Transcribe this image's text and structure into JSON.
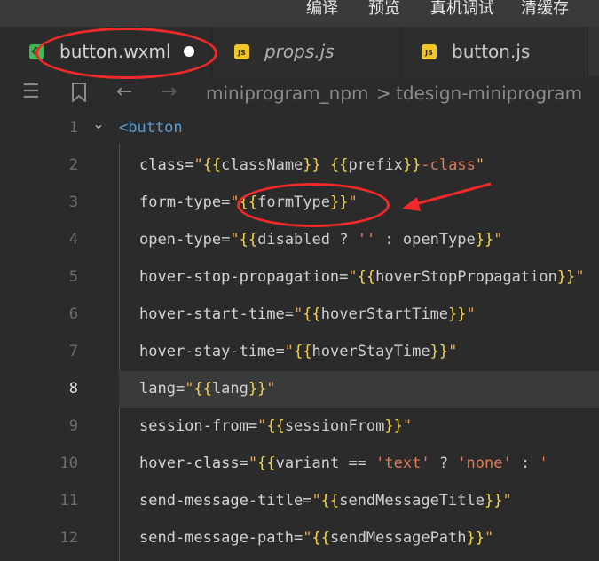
{
  "menu": {
    "items": [
      "编译",
      "预览",
      "真机调试",
      "清缓存"
    ]
  },
  "tabs": [
    {
      "label": "button.wxml",
      "icon": "wxml-file-icon",
      "active": true,
      "modified": true
    },
    {
      "label": "props.js",
      "icon": "js-file-icon",
      "active": false,
      "modified": false,
      "preview": true
    },
    {
      "label": "button.js",
      "icon": "js-file-icon",
      "active": false,
      "modified": false
    }
  ],
  "js_icon_text": "JS",
  "breadcrumb": {
    "items": [
      "miniprogram_npm",
      "tdesign-miniprogram"
    ],
    "separator": ">"
  },
  "editor": {
    "current_line": 8,
    "lines": [
      {
        "n": "1",
        "t": [
          [
            "tag",
            "<button"
          ]
        ]
      },
      {
        "n": "2",
        "t": [
          [
            "attr",
            "class"
          ],
          [
            "op",
            "="
          ],
          [
            "quote",
            "\""
          ],
          [
            "brace",
            "{{"
          ],
          [
            "var",
            "className"
          ],
          [
            "brace",
            "}}"
          ],
          [
            "op",
            " "
          ],
          [
            "brace",
            "{{"
          ],
          [
            "var",
            "prefix"
          ],
          [
            "brace",
            "}}"
          ],
          [
            "str",
            "-class"
          ],
          [
            "quote",
            "\""
          ]
        ]
      },
      {
        "n": "3",
        "t": [
          [
            "attr",
            "form-type"
          ],
          [
            "op",
            "="
          ],
          [
            "quote",
            "\""
          ],
          [
            "brace",
            "{{"
          ],
          [
            "var",
            "formType"
          ],
          [
            "brace",
            "}}"
          ],
          [
            "quote",
            "\""
          ]
        ]
      },
      {
        "n": "4",
        "t": [
          [
            "attr",
            "open-type"
          ],
          [
            "op",
            "="
          ],
          [
            "quote",
            "\""
          ],
          [
            "brace",
            "{{"
          ],
          [
            "var",
            "disabled ? "
          ],
          [
            "str",
            "''"
          ],
          [
            "var",
            " : openType"
          ],
          [
            "brace",
            "}}"
          ],
          [
            "quote",
            "\""
          ]
        ]
      },
      {
        "n": "5",
        "t": [
          [
            "attr",
            "hover-stop-propagation"
          ],
          [
            "op",
            "="
          ],
          [
            "quote",
            "\""
          ],
          [
            "brace",
            "{{"
          ],
          [
            "var",
            "hoverStopPropagation"
          ],
          [
            "brace",
            "}}"
          ],
          [
            "quote",
            "\""
          ]
        ]
      },
      {
        "n": "6",
        "t": [
          [
            "attr",
            "hover-start-time"
          ],
          [
            "op",
            "="
          ],
          [
            "quote",
            "\""
          ],
          [
            "brace",
            "{{"
          ],
          [
            "var",
            "hoverStartTime"
          ],
          [
            "brace",
            "}}"
          ],
          [
            "quote",
            "\""
          ]
        ]
      },
      {
        "n": "7",
        "t": [
          [
            "attr",
            "hover-stay-time"
          ],
          [
            "op",
            "="
          ],
          [
            "quote",
            "\""
          ],
          [
            "brace",
            "{{"
          ],
          [
            "var",
            "hoverStayTime"
          ],
          [
            "brace",
            "}}"
          ],
          [
            "quote",
            "\""
          ]
        ]
      },
      {
        "n": "8",
        "t": [
          [
            "attr",
            "lang"
          ],
          [
            "op",
            "="
          ],
          [
            "quote",
            "\""
          ],
          [
            "brace",
            "{{"
          ],
          [
            "var",
            "lang"
          ],
          [
            "brace",
            "}}"
          ],
          [
            "quote",
            "\""
          ]
        ]
      },
      {
        "n": "9",
        "t": [
          [
            "attr",
            "session-from"
          ],
          [
            "op",
            "="
          ],
          [
            "quote",
            "\""
          ],
          [
            "brace",
            "{{"
          ],
          [
            "var",
            "sessionFrom"
          ],
          [
            "brace",
            "}}"
          ],
          [
            "quote",
            "\""
          ]
        ]
      },
      {
        "n": "10",
        "t": [
          [
            "attr",
            "hover-class"
          ],
          [
            "op",
            "="
          ],
          [
            "quote",
            "\""
          ],
          [
            "brace",
            "{{"
          ],
          [
            "var",
            "variant == "
          ],
          [
            "str",
            "'text'"
          ],
          [
            "var",
            " ? "
          ],
          [
            "str",
            "'none'"
          ],
          [
            "var",
            " : "
          ],
          [
            "str",
            "'"
          ]
        ]
      },
      {
        "n": "11",
        "t": [
          [
            "attr",
            "send-message-title"
          ],
          [
            "op",
            "="
          ],
          [
            "quote",
            "\""
          ],
          [
            "brace",
            "{{"
          ],
          [
            "var",
            "sendMessageTitle"
          ],
          [
            "brace",
            "}}"
          ],
          [
            "quote",
            "\""
          ]
        ]
      },
      {
        "n": "12",
        "t": [
          [
            "attr",
            "send-message-path"
          ],
          [
            "op",
            "="
          ],
          [
            "quote",
            "\""
          ],
          [
            "brace",
            "{{"
          ],
          [
            "var",
            "sendMessagePath"
          ],
          [
            "brace",
            "}}"
          ],
          [
            "quote",
            "\""
          ]
        ]
      }
    ]
  },
  "colors": {
    "annotation": "#f02a2a",
    "background": "#2b2b2b",
    "tag": "#569cd6",
    "brace": "#f5d64a",
    "string": "#e07a57"
  }
}
